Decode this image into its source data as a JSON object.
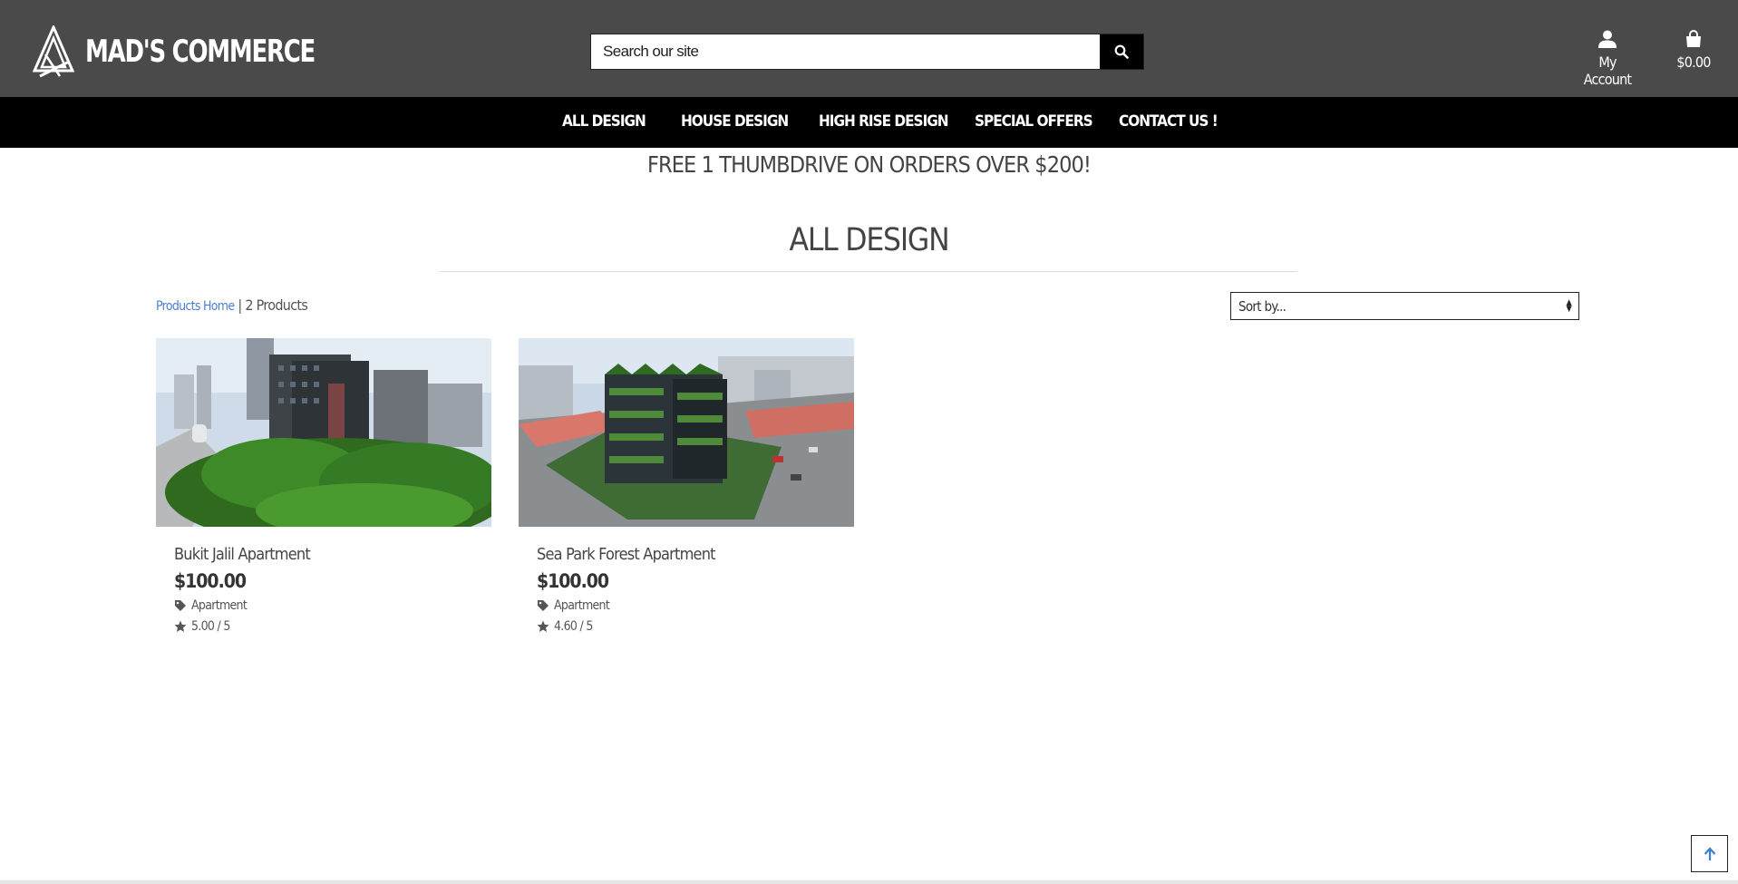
{
  "brand": {
    "name": "MAD'S COMMERCE"
  },
  "search": {
    "placeholder": "Search our site"
  },
  "header": {
    "account_label": "My Account",
    "cart_total": "$0.00"
  },
  "nav": {
    "items": [
      {
        "label": "ALL DESIGN"
      },
      {
        "label": "HOUSE DESIGN"
      },
      {
        "label": "HIGH RISE DESIGN"
      },
      {
        "label": "SPECIAL OFFERS"
      },
      {
        "label": "CONTACT US !"
      }
    ]
  },
  "promo": {
    "text": "FREE 1 THUMBDRIVE ON ORDERS OVER $200!"
  },
  "page": {
    "title": "ALL DESIGN"
  },
  "listing": {
    "breadcrumb_link": "Products Home",
    "separator": "|",
    "count": "2 Products",
    "sort_placeholder": "Sort by..."
  },
  "products": [
    {
      "name": "Bukit Jalil Apartment",
      "price": "$100.00",
      "category": "Apartment",
      "rating": "5.00 / 5"
    },
    {
      "name": "Sea Park Forest Apartment",
      "price": "$100.00",
      "category": "Apartment",
      "rating": "4.60 / 5"
    }
  ],
  "colors": {
    "header_bg": "#4a4a4a",
    "nav_bg": "#000000",
    "link": "#4a7fd0"
  }
}
